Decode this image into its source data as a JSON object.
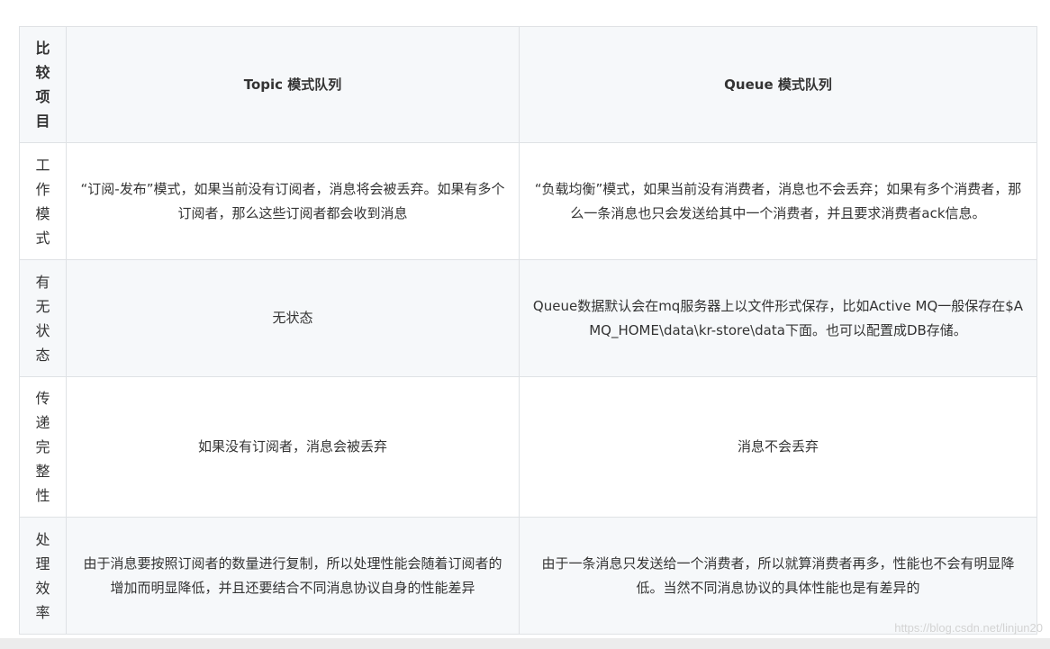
{
  "table": {
    "header": {
      "item": "比较项目",
      "topic": "Topic 模式队列",
      "queue": "Queue 模式队列"
    },
    "rows": [
      {
        "item": "工作模式",
        "topic": "“订阅-发布”模式，如果当前没有订阅者，消息将会被丢弃。如果有多个订阅者，那么这些订阅者都会收到消息",
        "queue": "“负载均衡”模式，如果当前没有消费者，消息也不会丢弃；如果有多个消费者，那么一条消息也只会发送给其中一个消费者，并且要求消费者ack信息。"
      },
      {
        "item": "有无状态",
        "topic": "无状态",
        "queue": "Queue数据默认会在mq服务器上以文件形式保存，比如Active MQ一般保存在$AMQ_HOME\\data\\kr-store\\data下面。也可以配置成DB存储。"
      },
      {
        "item": "传递完整性",
        "topic": "如果没有订阅者，消息会被丢弃",
        "queue": "消息不会丢弃"
      },
      {
        "item": "处理效率",
        "topic": "由于消息要按照订阅者的数量进行复制，所以处理性能会随着订阅者的增加而明显降低，并且还要结合不同消息协议自身的性能差异",
        "queue": "由于一条消息只发送给一个消费者，所以就算消费者再多，性能也不会有明显降低。当然不同消息协议的具体性能也是有差异的"
      }
    ]
  },
  "watermark": "https://blog.csdn.net/linjun20"
}
